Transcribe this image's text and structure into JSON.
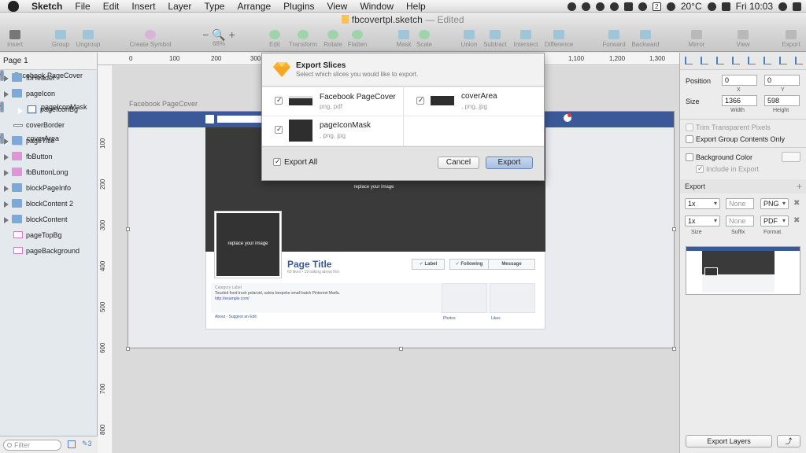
{
  "menubar": {
    "app_name": "Sketch",
    "items": [
      "File",
      "Edit",
      "Insert",
      "Layer",
      "Type",
      "Arrange",
      "Plugins",
      "View",
      "Window",
      "Help"
    ],
    "status": {
      "temperature": "20°C",
      "clock": "Fri 10:03",
      "badge": "2"
    }
  },
  "window": {
    "title": "fbcovertpl.sketch",
    "edited": "— Edited"
  },
  "toolbar": {
    "insert": "Insert",
    "group": "Group",
    "ungroup": "Ungroup",
    "create_symbol": "Create Symbol",
    "zoom_value": "68%",
    "edit": "Edit",
    "transform": "Transform",
    "rotate": "Rotate",
    "flatten": "Flatten",
    "mask": "Mask",
    "scale": "Scale",
    "union": "Union",
    "subtract": "Subtract",
    "intersect": "Intersect",
    "difference": "Difference",
    "forward": "Forward",
    "backward": "Backward",
    "mirror": "Mirror",
    "view": "View",
    "export": "Export"
  },
  "sidebar": {
    "page": "Page 1",
    "layers": [
      {
        "label": "Facebook PageCover"
      },
      {
        "label": "fbHeader"
      },
      {
        "label": "pageIcon"
      },
      {
        "label": "pageIconMask"
      },
      {
        "label": "pageIconBg"
      },
      {
        "label": "coverBorder"
      },
      {
        "label": "coverArea"
      },
      {
        "label": "pageTitle"
      },
      {
        "label": "fbButton"
      },
      {
        "label": "fbButtonLong"
      },
      {
        "label": "blockPageInfo"
      },
      {
        "label": "blockContent 2"
      },
      {
        "label": "blockContent"
      },
      {
        "label": "pageTopBg"
      },
      {
        "label": "pageBackground"
      }
    ],
    "filter_placeholder": "Filter",
    "footer_count": "3"
  },
  "ruler": {
    "top": [
      "0",
      "100",
      "200",
      "300",
      "1,100",
      "1,200",
      "1,300"
    ],
    "left": [
      "100",
      "200",
      "300",
      "400",
      "500",
      "600",
      "700",
      "800"
    ]
  },
  "canvas": {
    "artboard_label": "Facebook PageCover",
    "cover_text": "replace your image",
    "profile_text": "replace your image",
    "page_title": "Page Title",
    "page_sub": "69 likes • 19 talking about this",
    "btn_label": "✓ Label",
    "btn_following": "✓ Following",
    "btn_message": "Message",
    "category": "Category Label",
    "description": "Tousled food truck polaroid, salvia bespoke small batch Pinterest Marfa.",
    "link": "http://example.com/",
    "about": "About · Suggest an Edit",
    "photos": "Photos",
    "likes": "Likes"
  },
  "dialog": {
    "title": "Export Slices",
    "subtitle": "Select which slices you would like to export.",
    "slices": [
      {
        "name": "Facebook PageCover",
        "formats": "png, pdf",
        "checked": true
      },
      {
        "name": "coverArea",
        "formats": ", png, jpg",
        "checked": true
      },
      {
        "name": "pageIconMask",
        "formats": ", png, jpg",
        "checked": true
      }
    ],
    "export_all": "Export All",
    "cancel": "Cancel",
    "export": "Export"
  },
  "inspector": {
    "position_label": "Position",
    "x": "0",
    "y": "0",
    "x_label": "X",
    "y_label": "Y",
    "size_label": "Size",
    "width": "1366",
    "height": "598",
    "width_label": "Width",
    "height_label": "Height",
    "trim": "Trim Transparent Pixels",
    "export_group": "Export Group Contents Only",
    "bg_color": "Background Color",
    "include_export": "Include in Export",
    "export_section": "Export",
    "rows": [
      {
        "scale": "1x",
        "suffix": "None",
        "format": "PNG"
      },
      {
        "scale": "1x",
        "suffix": "None",
        "format": "PDF"
      }
    ],
    "col_size": "Size",
    "col_suffix": "Suffix",
    "col_format": "Format",
    "export_layers": "Export Layers"
  },
  "colors": {
    "selection": "#6a9fdf",
    "facebook": "#3b5998",
    "cover": "#3a3a3a"
  }
}
